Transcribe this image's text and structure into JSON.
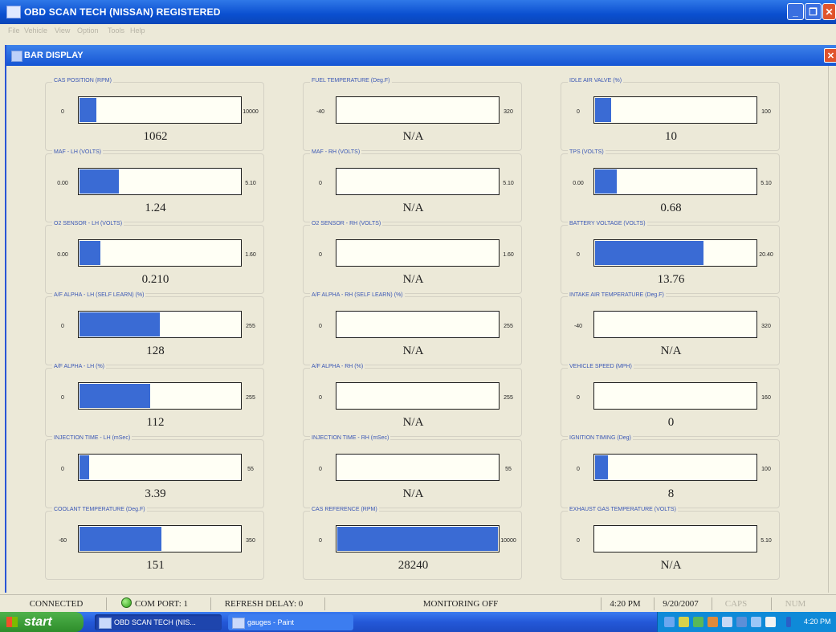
{
  "window": {
    "title": "OBD SCAN TECH (NISSAN) REGISTERED"
  },
  "menu": [
    "File",
    "Vehicle",
    "View",
    "Option",
    "Tools",
    "Help"
  ],
  "child_window": {
    "title": "BAR DISPLAY"
  },
  "gauges": [
    {
      "label": "CAS POSITION (RPM)",
      "min": "0",
      "max": "10000",
      "value": "1062",
      "fill": 0.1062
    },
    {
      "label": "FUEL TEMPERATURE (Deg.F)",
      "min": "-40",
      "max": "320",
      "value": "N/A",
      "fill": 0
    },
    {
      "label": "IDLE AIR VALVE (%)",
      "min": "0",
      "max": "100",
      "value": "10",
      "fill": 0.1
    },
    {
      "label": "MAF - LH (VOLTS)",
      "min": "0.00",
      "max": "5.10",
      "value": "1.24",
      "fill": 0.243
    },
    {
      "label": "MAF - RH (VOLTS)",
      "min": "0",
      "max": "5.10",
      "value": "N/A",
      "fill": 0
    },
    {
      "label": "TPS (VOLTS)",
      "min": "0.00",
      "max": "5.10",
      "value": "0.68",
      "fill": 0.133
    },
    {
      "label": "O2 SENSOR - LH (VOLTS)",
      "min": "0.00",
      "max": "1.60",
      "value": "0.210",
      "fill": 0.131
    },
    {
      "label": "O2 SENSOR - RH (VOLTS)",
      "min": "0",
      "max": "1.60",
      "value": "N/A",
      "fill": 0
    },
    {
      "label": "BATTERY VOLTAGE (VOLTS)",
      "min": "0",
      "max": "20.40",
      "value": "13.76",
      "fill": 0.675
    },
    {
      "label": "A/F ALPHA - LH (SELF LEARN) (%)",
      "min": "0",
      "max": "255",
      "value": "128",
      "fill": 0.502
    },
    {
      "label": "A/F ALPHA - RH (SELF LEARN) (%)",
      "min": "0",
      "max": "255",
      "value": "N/A",
      "fill": 0
    },
    {
      "label": "INTAKE AIR TEMPERATURE (Deg.F)",
      "min": "-40",
      "max": "320",
      "value": "N/A",
      "fill": 0
    },
    {
      "label": "A/F ALPHA - LH (%)",
      "min": "0",
      "max": "255",
      "value": "112",
      "fill": 0.439
    },
    {
      "label": "A/F ALPHA - RH (%)",
      "min": "0",
      "max": "255",
      "value": "N/A",
      "fill": 0
    },
    {
      "label": "VEHICLE SPEED (MPH)",
      "min": "0",
      "max": "160",
      "value": "0",
      "fill": 0
    },
    {
      "label": "INJECTION TIME - LH (mSec)",
      "min": "0",
      "max": "55",
      "value": "3.39",
      "fill": 0.062
    },
    {
      "label": "INJECTION TIME - RH (mSec)",
      "min": "0",
      "max": "55",
      "value": "N/A",
      "fill": 0
    },
    {
      "label": "IGNITION TIMING (Deg)",
      "min": "0",
      "max": "100",
      "value": "8",
      "fill": 0.08
    },
    {
      "label": "COOLANT TEMPERATURE (Deg.F)",
      "min": "-60",
      "max": "350",
      "value": "151",
      "fill": 0.51
    },
    {
      "label": "CAS REFERENCE (RPM)",
      "min": "0",
      "max": "10000",
      "value": "28240",
      "fill": 1.0
    },
    {
      "label": "EXHAUST GAS TEMPERATURE (VOLTS)",
      "min": "0",
      "max": "5.10",
      "value": "N/A",
      "fill": 0
    }
  ],
  "statusbar": {
    "connection": "CONNECTED",
    "com_port": "COM PORT: 1",
    "refresh_delay": "REFRESH DELAY: 0",
    "monitoring": "MONITORING OFF",
    "time": "4:20 PM",
    "date": "9/20/2007",
    "caps": "CAPS",
    "num": "NUM"
  },
  "taskbar": {
    "start_label": "start",
    "tasks": [
      "OBD SCAN TECH (NIS...",
      "gauges - Paint"
    ],
    "clock": "4:20 PM"
  },
  "colors": {
    "bar_fill": "#3a6bd4",
    "title_blue": "#0a4fd0"
  }
}
